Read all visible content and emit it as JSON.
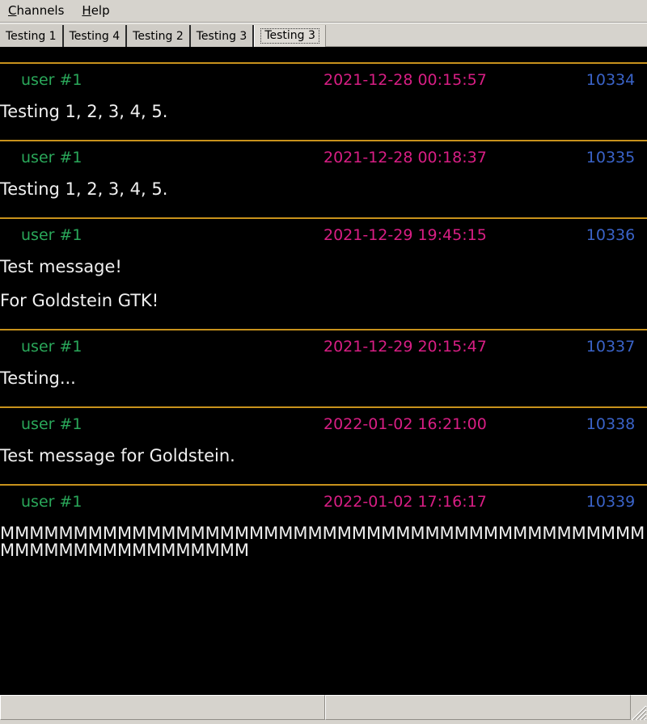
{
  "menubar": {
    "items": [
      {
        "name": "channels",
        "mnemonic": "C",
        "rest": "hannels"
      },
      {
        "name": "help",
        "mnemonic": "H",
        "rest": "elp"
      }
    ]
  },
  "tabs": [
    {
      "label": "Testing 1",
      "selected": false
    },
    {
      "label": "Testing 4",
      "selected": false
    },
    {
      "label": "Testing 2",
      "selected": false
    },
    {
      "label": "Testing 3",
      "selected": false
    },
    {
      "label": "Testing 3",
      "selected": true
    }
  ],
  "messages": [
    {
      "user": "user #1",
      "timestamp": "2021-12-28 00:15:57",
      "id": "10334",
      "lines": [
        "Testing 1, 2, 3, 4, 5."
      ]
    },
    {
      "user": "user #1",
      "timestamp": "2021-12-28 00:18:37",
      "id": "10335",
      "lines": [
        "Testing 1, 2, 3, 4, 5."
      ]
    },
    {
      "user": "user #1",
      "timestamp": "2021-12-29 19:45:15",
      "id": "10336",
      "lines": [
        "Test message!",
        "For Goldstein GTK!"
      ]
    },
    {
      "user": "user #1",
      "timestamp": "2021-12-29 20:15:47",
      "id": "10337",
      "lines": [
        "Testing..."
      ]
    },
    {
      "user": "user #1",
      "timestamp": "2022-01-02 16:21:00",
      "id": "10338",
      "lines": [
        "Test message for Goldstein."
      ]
    },
    {
      "user": "user #1",
      "timestamp": "2022-01-02 17:16:17",
      "id": "10339",
      "lines": [
        "MMMMMMMMMMMMMMMMMMMMMMMMMMMMMMMMMMMMMMMMMMMMMMMMMMMMMMMMMMMMM"
      ]
    }
  ],
  "statusbar": {
    "left_text": "",
    "right_text": ""
  },
  "colors": {
    "background": "#000000",
    "chrome": "#d6d3cd",
    "separator": "#c8921c",
    "username": "#2aa85a",
    "timestamp": "#d81e84",
    "message_id": "#3a63c8",
    "message_text": "#f0f0f0"
  }
}
